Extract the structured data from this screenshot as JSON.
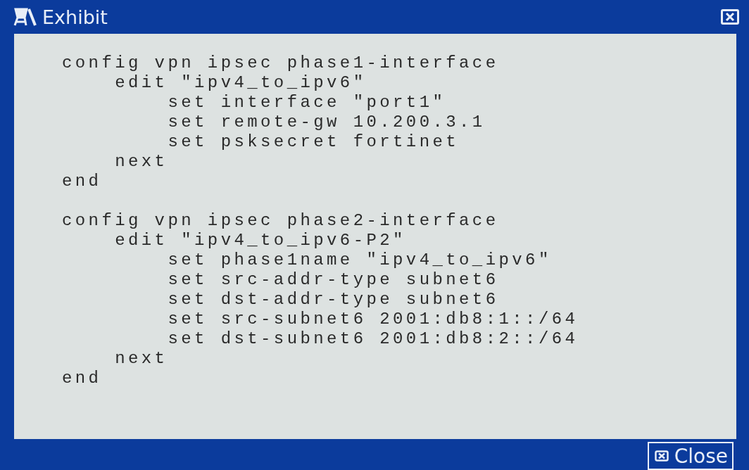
{
  "window": {
    "title": "Exhibit"
  },
  "code_blocks": [
    {
      "lines": [
        "config vpn ipsec phase1-interface",
        "    edit \"ipv4_to_ipv6\"",
        "        set interface \"port1\"",
        "        set remote-gw 10.200.3.1",
        "        set psksecret fortinet",
        "    next",
        "end"
      ]
    },
    {
      "lines": [
        "config vpn ipsec phase2-interface",
        "    edit \"ipv4_to_ipv6-P2\"",
        "        set phase1name \"ipv4_to_ipv6\"",
        "        set src-addr-type subnet6",
        "        set dst-addr-type subnet6",
        "        set src-subnet6 2001:db8:1::/64",
        "        set dst-subnet6 2001:db8:2::/64",
        "    next",
        "end"
      ]
    }
  ],
  "buttons": [
    {
      "label": "Close"
    }
  ]
}
